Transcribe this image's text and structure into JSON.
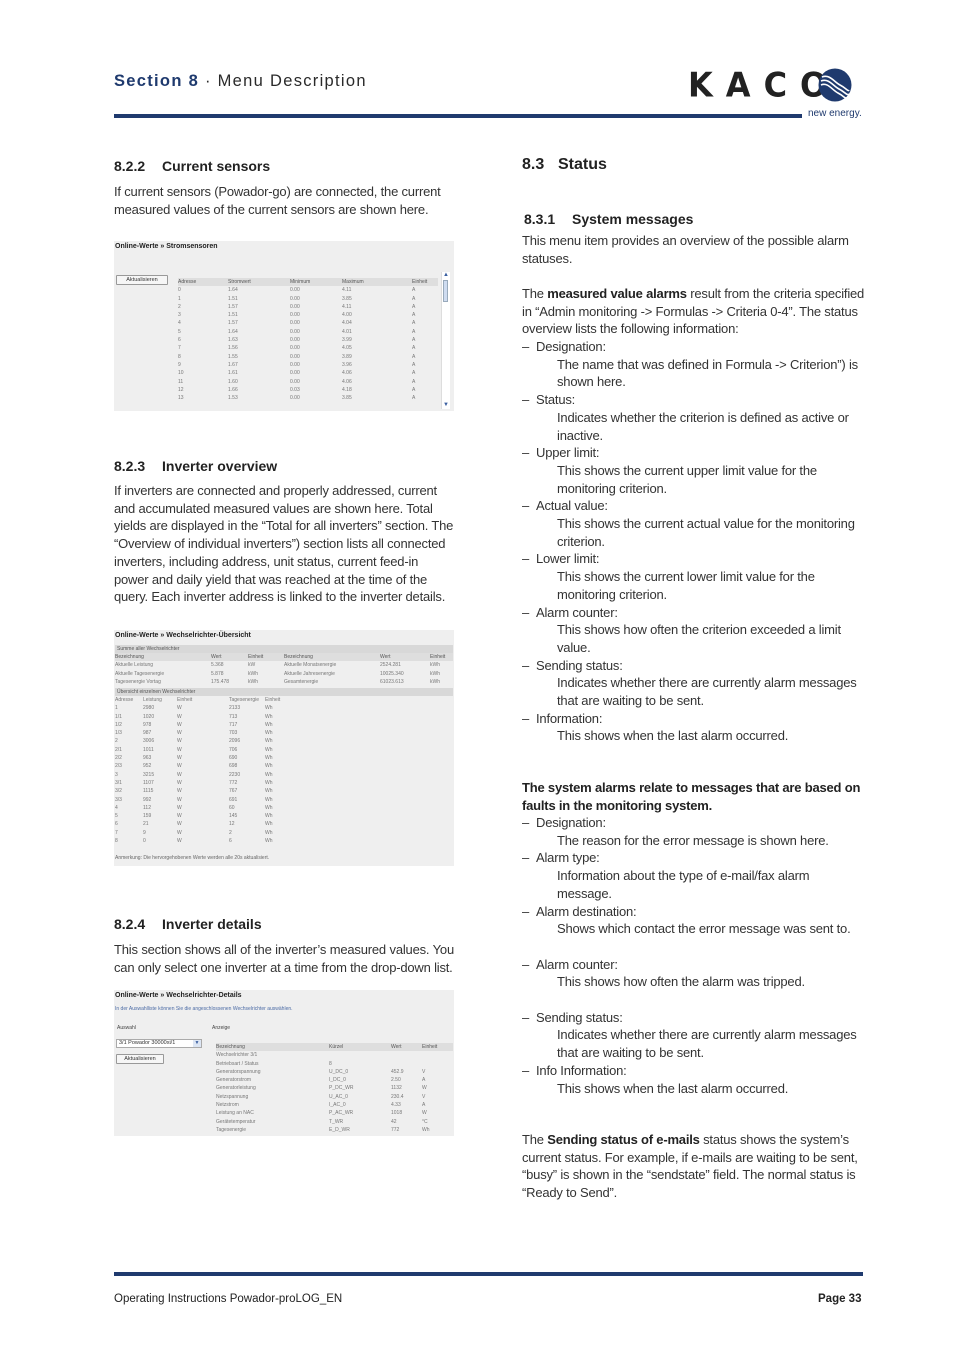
{
  "header": {
    "section_label": "Section 8",
    "separator": " · ",
    "section_title": "Menu Description",
    "logo_text": "KACO",
    "tagline": "new energy.",
    "brand_color": "#1f3a6e"
  },
  "left": {
    "s822": {
      "num": "8.2.2",
      "title": "Current sensors",
      "text": "If current sensors (Powador-go) are connected, the current measured values of the current sensors are shown here.",
      "screenshot": {
        "title": "Online-Werte » Stromsensoren",
        "button": "Aktualisieren",
        "columns": [
          "Adresse",
          "Stromwert",
          "Minimum",
          "Maximum",
          "Einheit"
        ],
        "rows": [
          [
            "0",
            "1.64",
            "0.00",
            "4.11",
            "A"
          ],
          [
            "1",
            "1.51",
            "0.00",
            "3.85",
            "A"
          ],
          [
            "2",
            "1.57",
            "0.00",
            "4.11",
            "A"
          ],
          [
            "3",
            "1.51",
            "0.00",
            "4.00",
            "A"
          ],
          [
            "4",
            "1.57",
            "0.00",
            "4.04",
            "A"
          ],
          [
            "5",
            "1.64",
            "0.00",
            "4.01",
            "A"
          ],
          [
            "6",
            "1.63",
            "0.00",
            "3.99",
            "A"
          ],
          [
            "7",
            "1.56",
            "0.00",
            "4.05",
            "A"
          ],
          [
            "8",
            "1.55",
            "0.00",
            "3.89",
            "A"
          ],
          [
            "9",
            "1.67",
            "0.00",
            "3.96",
            "A"
          ],
          [
            "10",
            "1.61",
            "0.00",
            "4.06",
            "A"
          ],
          [
            "11",
            "1.60",
            "0.00",
            "4.06",
            "A"
          ],
          [
            "12",
            "1.66",
            "0.03",
            "4.18",
            "A"
          ],
          [
            "13",
            "1.53",
            "0.00",
            "3.85",
            "A"
          ]
        ]
      }
    },
    "s823": {
      "num": "8.2.3",
      "title": "Inverter overview",
      "text": "If inverters are connected and properly addressed, current and accumulated measured values are shown here. Total yields are displayed in the “Total for all inverters” section. The “Overview of individual inverters”) section lists all connected inverters, including address, unit status, current feed-in power and daily yield that was reached at the time of the query. Each inverter address is linked to the inverter details.",
      "screenshot": {
        "title": "Online-Werte » Wechselrichter-Übersicht",
        "sum_heading": "Summe aller Wechselrichter",
        "sum_columns": [
          "Bezeichnung",
          "Wert",
          "Einheit",
          "Bezeichnung",
          "Wert",
          "Einheit"
        ],
        "sum_rows": [
          [
            "Aktuelle Leistung",
            "5.368",
            "kW",
            "Aktuelle Monatsenergie",
            "2524.281",
            "kWh"
          ],
          [
            "Aktuelle Tagesenergie",
            "5.878",
            "kWh",
            "Aktuelle Jahresenergie",
            "10025.340",
            "kWh"
          ],
          [
            "Tagesenergie Vortag",
            "175.478",
            "kWh",
            "Gesamtenergie",
            "61023.613",
            "kWh"
          ]
        ],
        "ind_heading": "Übersicht einzelnen Wechselrichter",
        "ind_columns": [
          "Adresse",
          "Leistung",
          "Einheit",
          "Tagesenergie",
          "Einheit"
        ],
        "ind_rows": [
          [
            "1",
            "2980",
            "W",
            "2133",
            "Wh"
          ],
          [
            "1/1",
            "1020",
            "W",
            "713",
            "Wh"
          ],
          [
            "1/2",
            "978",
            "W",
            "717",
            "Wh"
          ],
          [
            "1/3",
            "987",
            "W",
            "703",
            "Wh"
          ],
          [
            "2",
            "3006",
            "W",
            "2096",
            "Wh"
          ],
          [
            "2/1",
            "1011",
            "W",
            "706",
            "Wh"
          ],
          [
            "2/2",
            "963",
            "W",
            "690",
            "Wh"
          ],
          [
            "2/3",
            "952",
            "W",
            "698",
            "Wh"
          ],
          [
            "3",
            "3215",
            "W",
            "2230",
            "Wh"
          ],
          [
            "3/1",
            "1107",
            "W",
            "772",
            "Wh"
          ],
          [
            "3/2",
            "1115",
            "W",
            "767",
            "Wh"
          ],
          [
            "3/3",
            "992",
            "W",
            "691",
            "Wh"
          ],
          [
            "4",
            "112",
            "W",
            "60",
            "Wh"
          ],
          [
            "5",
            "159",
            "W",
            "145",
            "Wh"
          ],
          [
            "6",
            "21",
            "W",
            "12",
            "Wh"
          ],
          [
            "7",
            "9",
            "W",
            "2",
            "Wh"
          ],
          [
            "8",
            "0",
            "W",
            "6",
            "Wh"
          ]
        ],
        "note": "Anmerkung: Die hervorgehobenen Werte werden alle 20s aktualisiert."
      }
    },
    "s824": {
      "num": "8.2.4",
      "title": "Inverter details",
      "text": "This section shows all of the inverter’s measured values. You can only select one inverter at a time from the drop-down list.",
      "screenshot": {
        "title": "Online-Werte » Wechselrichter-Details",
        "hint": "In der Auswahlliste können Sie die angeschlossenen Wechselrichter auswählen.",
        "select_label": "Auswahl",
        "display_label": "Anzeige",
        "select_value": "3/1 Powador 30000xi/1",
        "button": "Aktualisieren",
        "columns": [
          "Bezeichnung",
          "Kürzel",
          "Wert",
          "Einheit"
        ],
        "subheading": "Wechselrichter 3/1",
        "rows": [
          [
            "Betriebsart / Status",
            "8",
            "",
            ""
          ],
          [
            "Generatorspannung",
            "U_DC_0",
            "452.9",
            "V"
          ],
          [
            "Generatorstrom",
            "I_DC_0",
            "2.50",
            "A"
          ],
          [
            "Generatorleistung",
            "P_DC_WR",
            "1132",
            "W"
          ],
          [
            "Netzspannung",
            "U_AC_0",
            "230.4",
            "V"
          ],
          [
            "Netzstrom",
            "I_AC_0",
            "4.33",
            "A"
          ],
          [
            "Leistung an NAC",
            "P_AC_WR",
            "1018",
            "W"
          ],
          [
            "Gerätetemperatur",
            "T_WR",
            "42",
            "°C"
          ],
          [
            "Tagesenergie",
            "E_D_WR",
            "772",
            "Wh"
          ]
        ]
      }
    }
  },
  "right": {
    "s83": {
      "num": "8.3",
      "title": "Status"
    },
    "s831": {
      "num": "8.3.1",
      "title": "System messages",
      "intro": "This menu item provides an overview of the possible alarm statuses.",
      "mva_pre": "The ",
      "mva_bold": "measured value alarms",
      "mva_post": " result from the criteria specified in “Admin monitoring -> Formulas -> Criteria 0-4”. The status overview lists the following information:",
      "mva_items": [
        {
          "term": "Designation:",
          "desc": "The name that was defined in Formula -> Criterion”) is shown here."
        },
        {
          "term": "Status:",
          "desc": "Indicates whether the criterion is defined as active or inactive."
        },
        {
          "term": "Upper limit:",
          "desc": "This shows the current upper limit value for the monitoring criterion."
        },
        {
          "term": "Actual value:",
          "desc": "This shows the current actual value for the monitoring criterion."
        },
        {
          "term": "Lower limit:",
          "desc": "This shows the current lower limit value for the monitoring criterion."
        },
        {
          "term": "Alarm counter:",
          "desc": "This shows how often the criterion exceeded a limit value."
        },
        {
          "term": "Sending status:",
          "desc": "Indicates whether there are currently alarm messages that are waiting to be sent."
        },
        {
          "term": "Information:",
          "desc": "This shows when the last alarm occurred."
        }
      ],
      "sys_heading": "The system alarms relate to messages that are based on faults in the monitoring system.",
      "sys_items": [
        {
          "term": "Designation:",
          "desc": "The reason for the error message is shown here."
        },
        {
          "term": "Alarm type:",
          "desc": "Information about the type of e-mail/fax alarm message."
        },
        {
          "term": "Alarm destination:",
          "desc": "Shows which contact the error message was sent to."
        },
        {
          "term": "Alarm counter:",
          "desc": "This shows how often the alarm was tripped."
        },
        {
          "term": "Sending status:",
          "desc": "Indicates whether there are currently alarm messages that are waiting to be sent."
        },
        {
          "term": "Info Information:",
          "desc": "This shows when the last alarm occurred."
        }
      ],
      "send_pre": "The ",
      "send_bold": "Sending status of e-mails",
      "send_post": " status shows the system’s current status. For example, if e-mails are waiting to be sent, “busy” is shown in the “sendstate” field. The normal status is “Ready to Send”."
    }
  },
  "footer": {
    "doc_title": "Operating Instructions Powador-proLOG_EN",
    "page": "Page 33"
  }
}
